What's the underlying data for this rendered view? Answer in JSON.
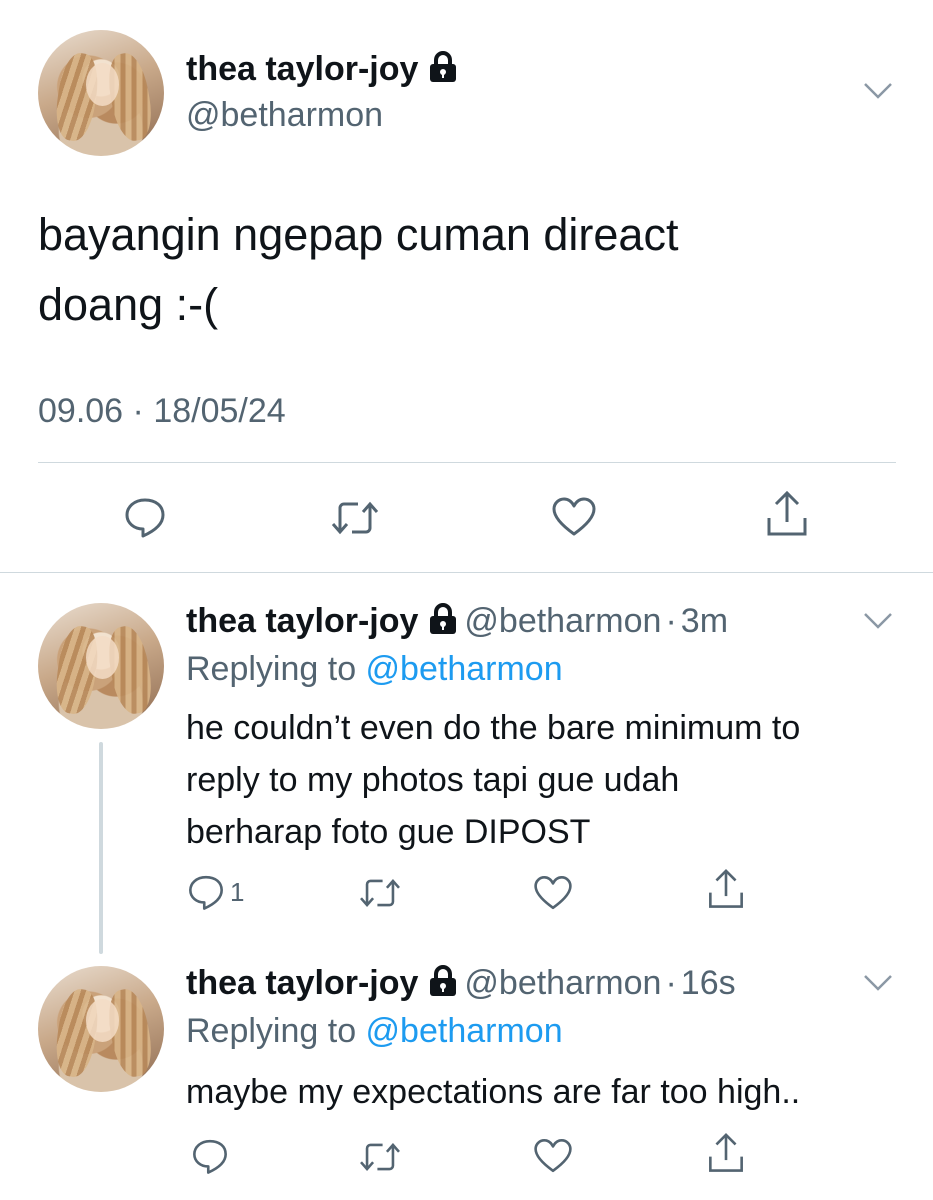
{
  "main_tweet": {
    "display_name": "thea taylor-joy",
    "handle": "@betharmon",
    "text_line1": "bayangin ngepap cuman direact",
    "text_line2": "doang :-(",
    "time": "09.06",
    "date": "18/05/24",
    "meta_separator": "·"
  },
  "replies": [
    {
      "display_name": "thea taylor-joy",
      "handle": "@betharmon",
      "time_ago": "3m",
      "separator": "·",
      "replying_prefix": "Replying to ",
      "replying_to": "@betharmon",
      "text_line1": "he couldn’t even do the bare minimum to",
      "text_line2": "reply to my photos tapi gue udah",
      "text_line3": "berharap foto gue DIPOST",
      "reply_count": "1"
    },
    {
      "display_name": "thea taylor-joy",
      "handle": "@betharmon",
      "time_ago": "16s",
      "separator": "·",
      "replying_prefix": "Replying to ",
      "replying_to": "@betharmon",
      "text_line1": "maybe my expectations are far too high..",
      "reply_count": ""
    }
  ],
  "colors": {
    "text": "#0f1419",
    "secondary": "#536471",
    "link": "#1d9bf0",
    "divider": "#cfd9de"
  }
}
